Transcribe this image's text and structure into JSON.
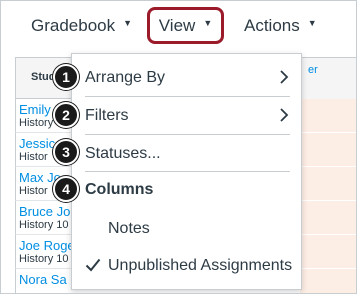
{
  "toolbar": {
    "gradebook_label": "Gradebook",
    "view_label": "View",
    "actions_label": "Actions",
    "caret_glyph": "▼"
  },
  "table": {
    "student_header": "Student",
    "right_header": "er",
    "students": [
      {
        "name": "Emily",
        "section": "History"
      },
      {
        "name": "Jessica",
        "section": "Histor"
      },
      {
        "name": "Max Jo",
        "section": "Histor"
      },
      {
        "name": "Bruce Jo",
        "section": "History 10"
      },
      {
        "name": "Joe Roge",
        "section": "History 10"
      },
      {
        "name": "Nora Sa",
        "section": ""
      }
    ]
  },
  "menu": {
    "items": [
      {
        "label": "Arrange By",
        "badge": "1",
        "has_submenu": true
      },
      {
        "label": "Filters",
        "badge": "2",
        "has_submenu": true
      },
      {
        "label": "Statuses...",
        "badge": "3",
        "has_submenu": false
      }
    ],
    "columns_header": {
      "label": "Columns",
      "badge": "4"
    },
    "column_options": [
      {
        "label": "Notes",
        "checked": false
      },
      {
        "label": "Unpublished Assignments",
        "checked": true
      }
    ]
  },
  "colors": {
    "view_highlight_border": "#9b1b2a",
    "link_blue": "#008ee2",
    "text": "#2d3b45",
    "badge": "#1a1a1a",
    "cell_tint": "#fdeee5"
  }
}
